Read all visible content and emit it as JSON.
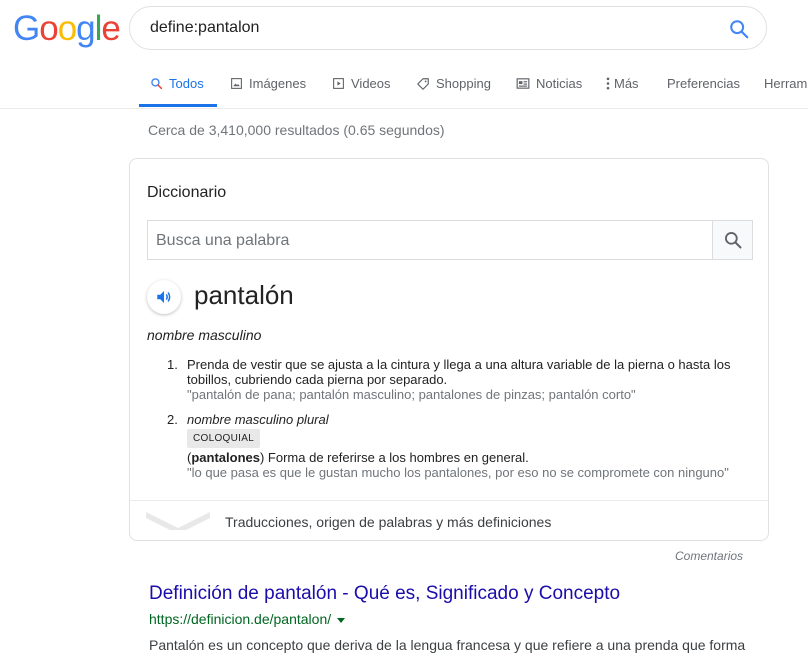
{
  "logo": {
    "letters": [
      "G",
      "o",
      "o",
      "g",
      "l",
      "e"
    ],
    "colors": [
      "#4285f4",
      "#ea4335",
      "#fbbc05",
      "#4285f4",
      "#34a853",
      "#ea4335"
    ]
  },
  "search": {
    "query": "define:pantalon",
    "icon": "search-icon",
    "icon_color": "#4285f4"
  },
  "tabs": [
    {
      "label": "Todos",
      "icon": "search-icon"
    },
    {
      "label": "Imágenes",
      "icon": "image-icon"
    },
    {
      "label": "Videos",
      "icon": "play-icon"
    },
    {
      "label": "Shopping",
      "icon": "tag-icon"
    },
    {
      "label": "Noticias",
      "icon": "news-icon"
    },
    {
      "label": "Más",
      "icon": "more-vert-icon"
    },
    {
      "label": "Preferencias"
    },
    {
      "label": "Herram"
    }
  ],
  "result_stats": "Cerca de 3,410,000 resultados (0.65 segundos)",
  "dictionary": {
    "title": "Diccionario",
    "input_placeholder": "Busca una palabra",
    "word": "pantalón",
    "part_of_speech": "nombre masculino",
    "definitions": [
      {
        "number": "1.",
        "text": "Prenda de vestir que se ajusta a la cintura y llega a una altura variable de la pierna o hasta los tobillos, cubriendo cada pierna por separado.",
        "example": "\"pantalón de pana; pantalón masculino; pantalones de pinzas; pantalón corto\""
      },
      {
        "number": "2.",
        "pos": "nombre masculino plural",
        "badge": "COLOQUIAL",
        "bold_word": "pantalones",
        "text": " Forma de referirse a los hombres en general.",
        "example": "\"lo que pasa es que le gustan mucho los pantalones, por eso no se compromete con ninguno\""
      }
    ],
    "footer": "Traducciones, origen de palabras y más definiciones"
  },
  "feedback": "Comentarios",
  "result": {
    "title": "Definición de pantalón - Qué es, Significado y Concepto",
    "url": "https://definicion.de/pantalon/",
    "snippet": "Pantalón es un concepto que deriva de la lengua francesa y que refiere a una prenda que forma"
  }
}
